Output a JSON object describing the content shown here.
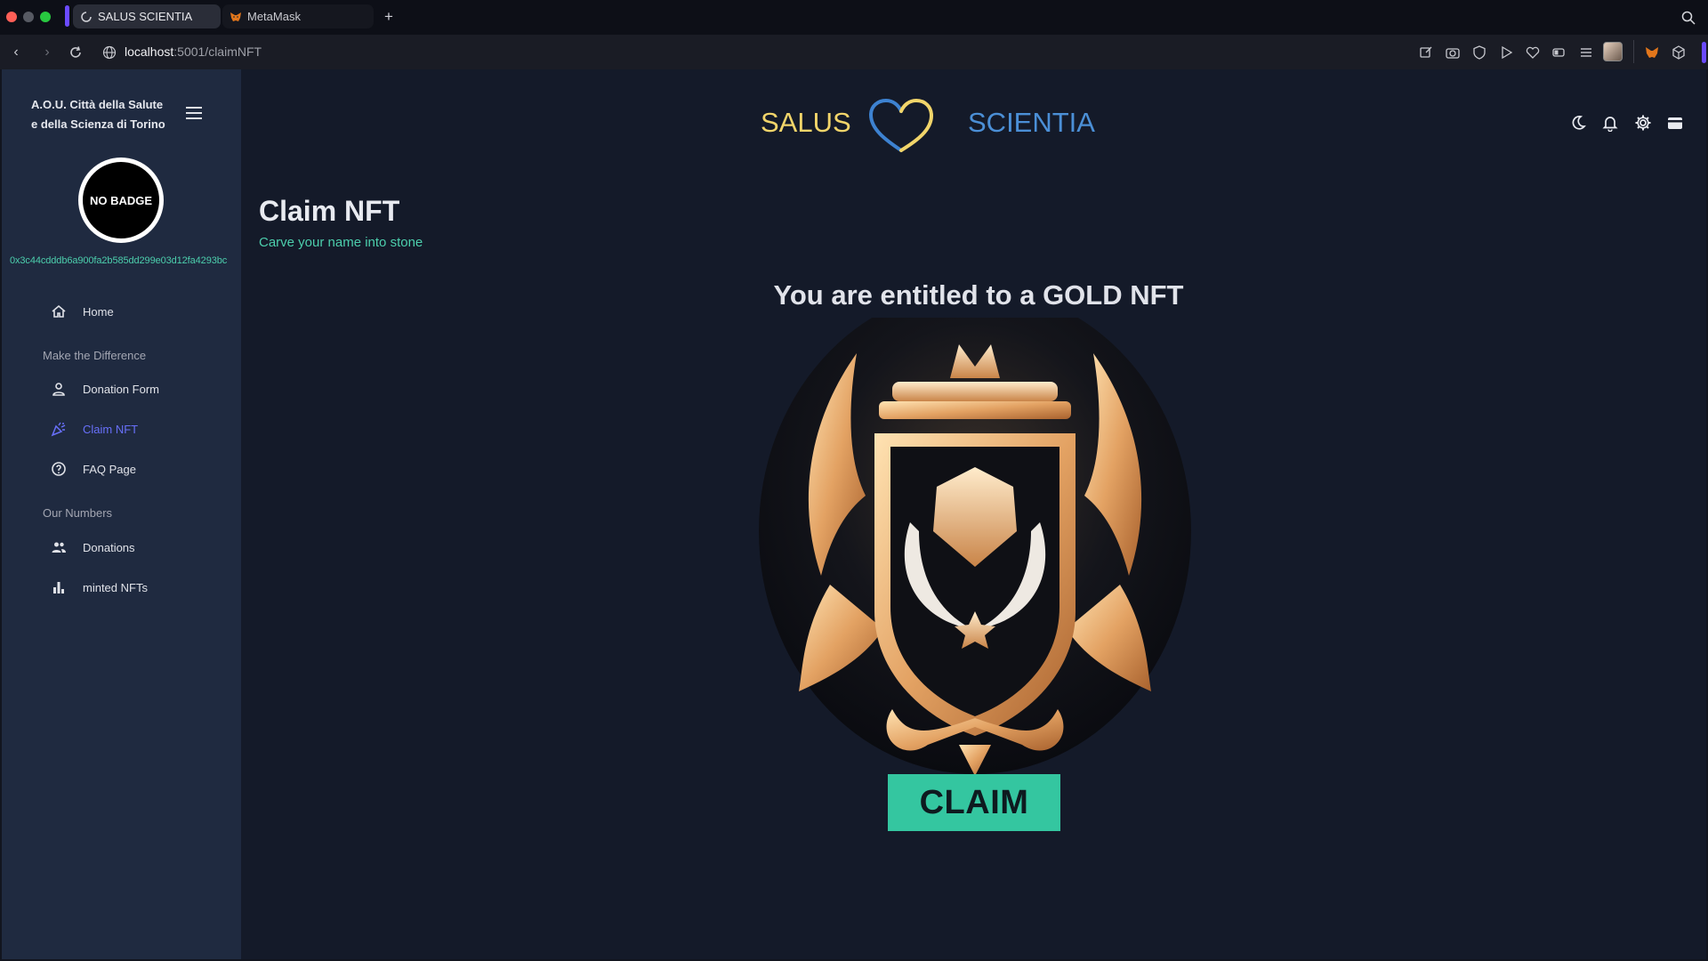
{
  "browser": {
    "tabs": [
      {
        "label": "SALUS SCIENTIA",
        "active": true
      },
      {
        "label": "MetaMask",
        "active": false
      }
    ],
    "url_host": "localhost",
    "url_path": ":5001/claimNFT"
  },
  "sidebar": {
    "org_line1": "A.O.U. Città della Salute",
    "org_line2": "e della Scienza di Torino",
    "badge_text": "NO BADGE",
    "wallet_address": "0x3c44cdddb6a900fa2b585dd299e03d12fa4293bc",
    "items": [
      {
        "label": "Home",
        "icon": "home-icon"
      },
      {
        "label": "Donation Form",
        "icon": "person-icon"
      },
      {
        "label": "Claim NFT",
        "icon": "party-popper-icon",
        "active": true
      },
      {
        "label": "FAQ Page",
        "icon": "help-circle-icon"
      },
      {
        "label": "Donations",
        "icon": "people-icon"
      },
      {
        "label": "minted NFTs",
        "icon": "bar-chart-icon"
      }
    ],
    "sections": [
      "Make the Difference",
      "Our Numbers"
    ]
  },
  "header": {
    "logo_left": "SALUS",
    "logo_right": "SCIENTIA"
  },
  "main": {
    "title": "Claim NFT",
    "subtitle": "Carve your name into stone",
    "entitled_text": "You are entitled to a GOLD NFT",
    "claim_label": "CLAIM"
  },
  "colors": {
    "accent_green": "#4cceac",
    "accent_blue": "#6870fa",
    "gold": "#f2d56a",
    "logo_blue": "#4b8fd6"
  }
}
